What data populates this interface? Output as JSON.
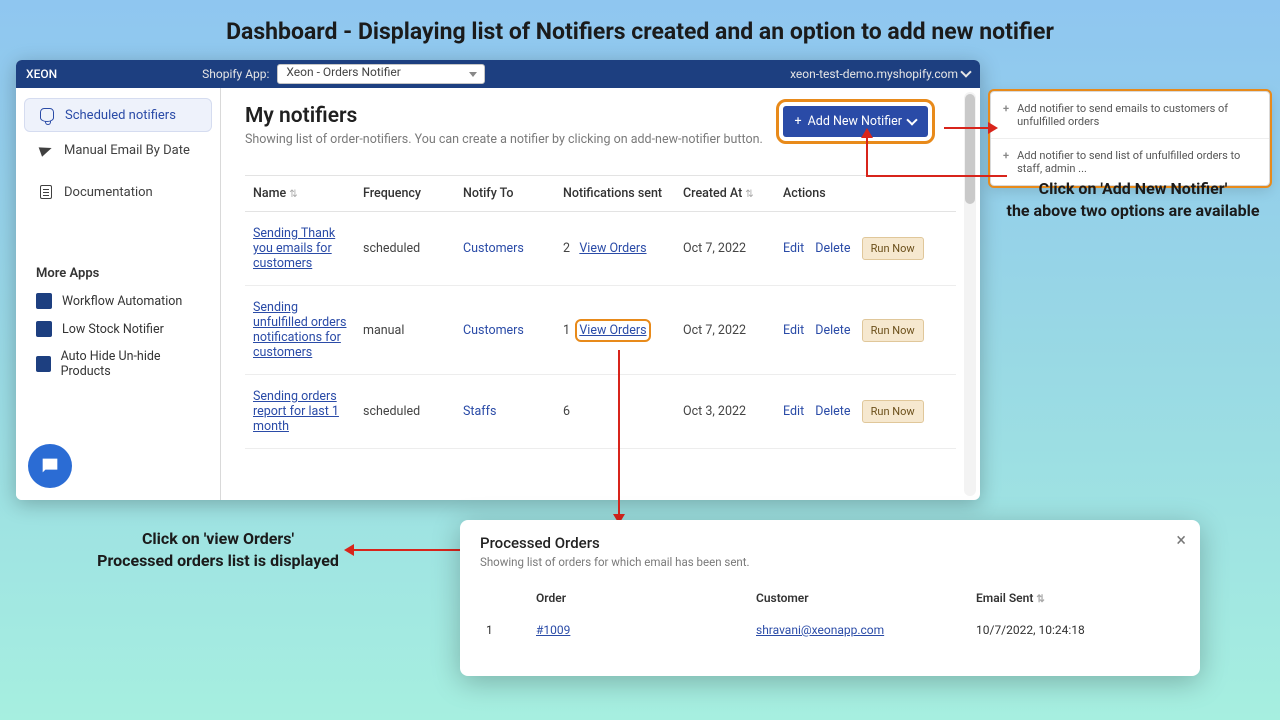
{
  "annotation": {
    "title": "Dashboard - Displaying list of Notifiers created and an option to add new notifier",
    "right_line1": "Click on 'Add New Notifier'",
    "right_line2": "the above two options are available",
    "left_line1": "Click on 'view Orders'",
    "left_line2": "Processed orders list is displayed"
  },
  "topbar": {
    "brand": "XEON",
    "app_label": "Shopify App:",
    "app_selected": "Xeon - Orders Notifier",
    "store": "xeon-test-demo.myshopify.com"
  },
  "sidebar": {
    "items": [
      {
        "label": "Scheduled notifiers"
      },
      {
        "label": "Manual Email By Date"
      },
      {
        "label": "Documentation"
      }
    ],
    "more_apps_title": "More Apps",
    "more_apps": [
      {
        "label": "Workflow Automation"
      },
      {
        "label": "Low Stock Notifier"
      },
      {
        "label": "Auto Hide Un-hide Products"
      }
    ]
  },
  "main": {
    "title": "My notifiers",
    "subtitle": "Showing list of order-notifiers. You can create a notifier by clicking on add-new-notifier button.",
    "add_btn": "Add New Notifier",
    "columns": {
      "name": "Name",
      "frequency": "Frequency",
      "notify_to": "Notify To",
      "notifications_sent": "Notifications sent",
      "created_at": "Created At",
      "actions": "Actions"
    },
    "action_labels": {
      "edit": "Edit",
      "delete": "Delete",
      "run": "Run Now",
      "view_orders": "View Orders"
    },
    "rows": [
      {
        "name": "Sending Thank you emails for customers",
        "frequency": "scheduled",
        "notify_to": "Customers",
        "sent": "2",
        "view_orders": true,
        "created": "Oct 7, 2022"
      },
      {
        "name": "Sending unfulfilled orders notifications for customers",
        "frequency": "manual",
        "notify_to": "Customers",
        "sent": "1",
        "view_orders": true,
        "created": "Oct 7, 2022",
        "highlight_view": true
      },
      {
        "name": "Sending orders report for last 1 month",
        "frequency": "scheduled",
        "notify_to": "Staffs",
        "sent": "6",
        "view_orders": false,
        "created": "Oct 3, 2022"
      }
    ]
  },
  "dropdown": {
    "opt1": "Add notifier to send emails to customers of unfulfilled orders",
    "opt2": "Add notifier to send list of unfulfilled orders to staff, admin ..."
  },
  "modal": {
    "title": "Processed Orders",
    "subtitle": "Showing list of orders for which email has been sent.",
    "columns": {
      "idx": "",
      "order": "Order",
      "customer": "Customer",
      "email_sent": "Email Sent"
    },
    "rows": [
      {
        "idx": "1",
        "order": "#1009",
        "customer": "shravani@xeonapp.com",
        "email_sent": "10/7/2022, 10:24:18"
      }
    ]
  }
}
